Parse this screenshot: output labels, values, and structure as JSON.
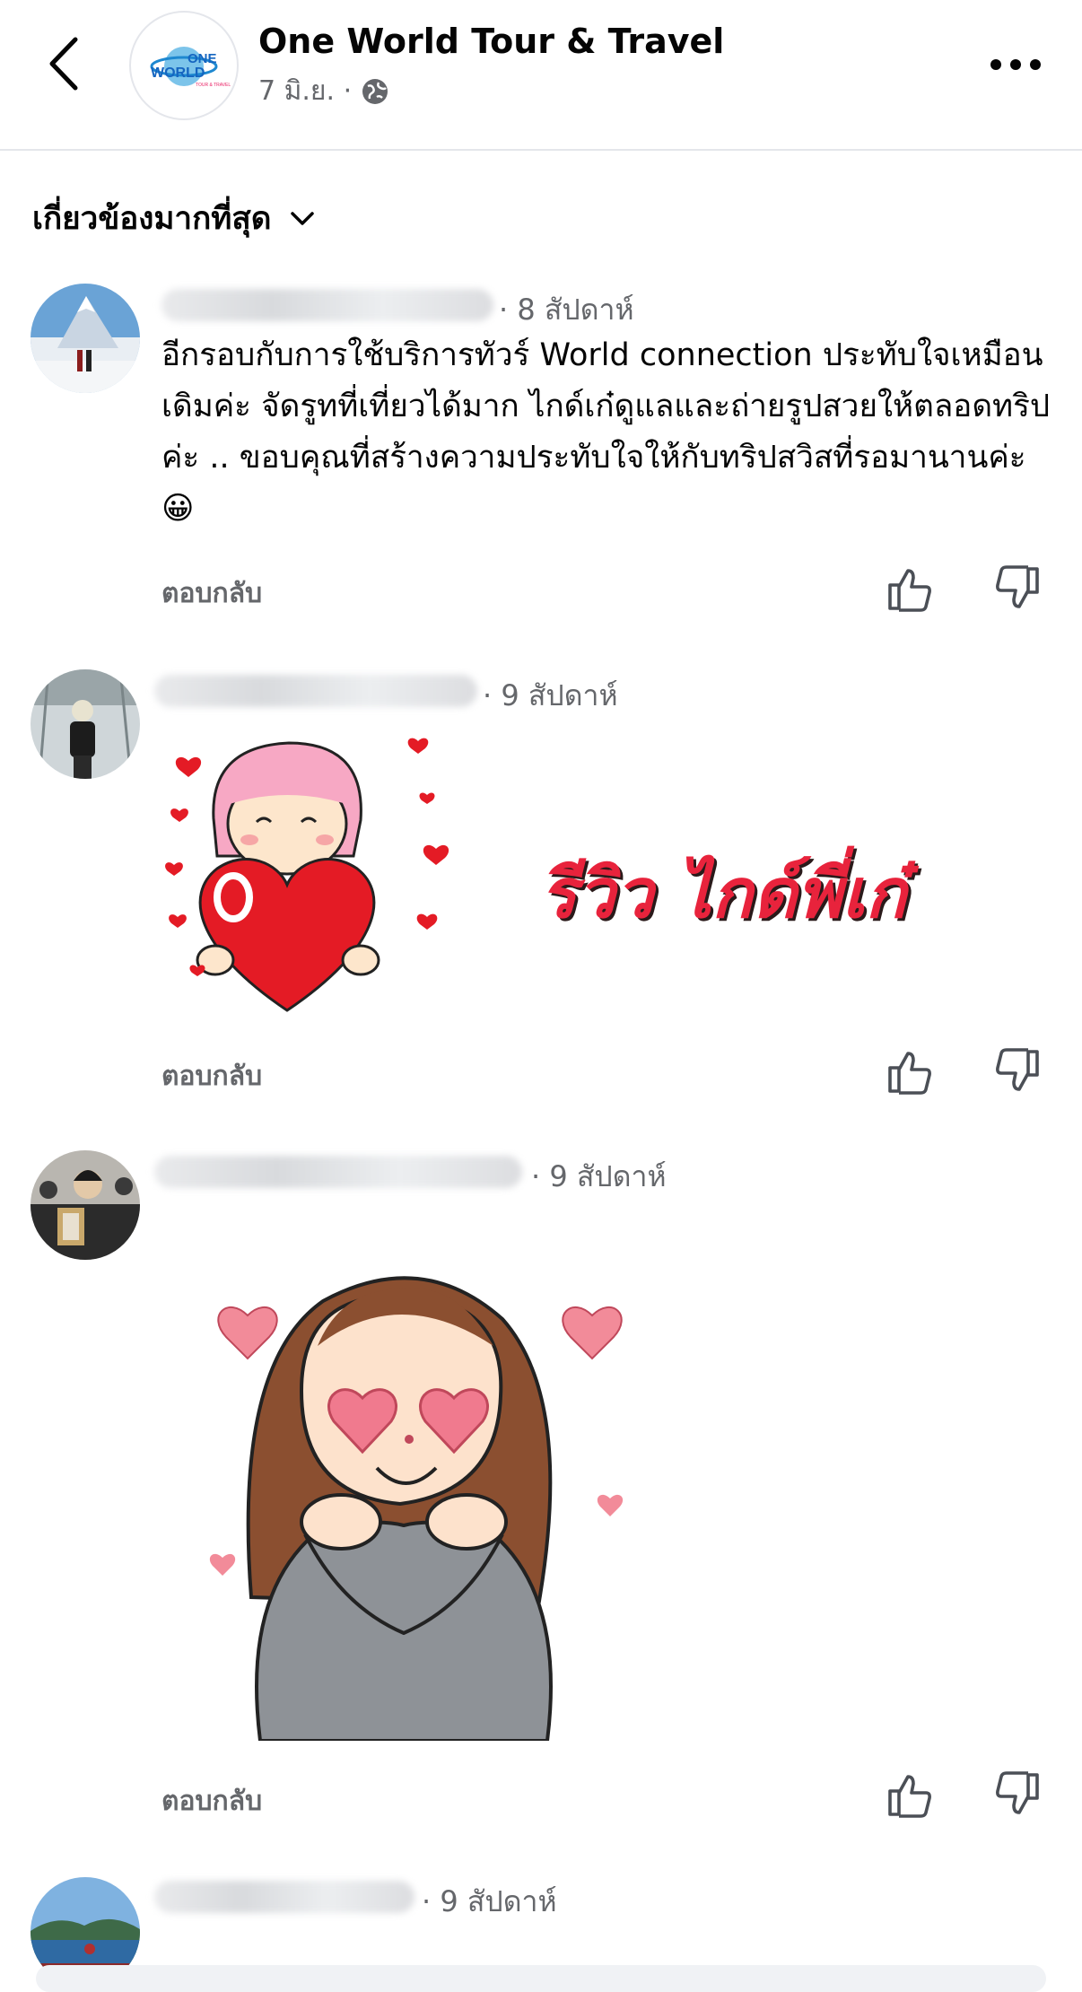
{
  "header": {
    "page_name": "One World Tour & Travel",
    "post_date": "7 มิ.ย. ·",
    "avatar_logo_text": "ONE WORLD"
  },
  "sort": {
    "label": "เกี่ยวข้องมากที่สุด"
  },
  "comments": [
    {
      "time": "· 8 สัปดาห์",
      "text": "อีกรอบกับการใช้บริการทัวร์ World connection ประทับใจเหมือนเดิมค่ะ จัดรูทที่เที่ยวได้มาก ไกด์เก๋ดูแลและถ่ายรูปสวยให้ตลอดทริปค่ะ .. ขอบคุณที่สร้างความประทับใจให้กับทริปสวิสที่รอมานานค่ะ 😀",
      "reply": "ตอบกลับ"
    },
    {
      "time": "· 9 สัปดาห์",
      "sticker_text": "รีวิว ไกด์พี่เก๋",
      "reply": "ตอบกลับ"
    },
    {
      "time": "· 9 สัปดาห์",
      "reply": "ตอบกลับ"
    },
    {
      "time": "· 9 สัปดาห์"
    }
  ],
  "colors": {
    "secondary_text": "#65676b",
    "sticker_red": "#e8233c",
    "divider": "#e4e6eb"
  }
}
